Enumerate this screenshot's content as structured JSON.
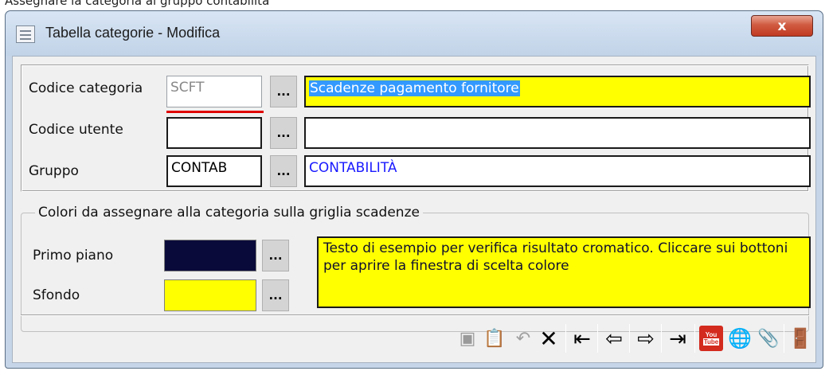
{
  "caption": "Assegnare la categoria al gruppo contabilità",
  "window": {
    "title": "Tabella categorie - Modifica",
    "close_label": "x"
  },
  "fields": {
    "codice_categoria": {
      "label": "Codice categoria",
      "code": "SCFT",
      "description": "Scadenze pagamento fornitore"
    },
    "codice_utente": {
      "label": "Codice utente",
      "code": "",
      "description": ""
    },
    "gruppo": {
      "label": "Gruppo",
      "code": "CONTAB",
      "description": "CONTABILITÀ"
    }
  },
  "dots_label": "...",
  "colors": {
    "legend": "Colori da assegnare alla categoria sulla griglia scadenze",
    "primo_piano": {
      "label": "Primo piano",
      "color": "#0a0a3a"
    },
    "sfondo": {
      "label": "Sfondo",
      "color": "#ffff00"
    },
    "sample_text": "Testo di esempio per verifica risultato cromatico. Cliccare sui bottoni per aprire la finestra di scelta colore"
  },
  "toolbar": [
    {
      "name": "save-icon",
      "glyph": "💾",
      "enabled": false
    },
    {
      "name": "clipboard-icon",
      "glyph": "📋",
      "enabled": true
    },
    {
      "name": "undo-icon",
      "glyph": "↶",
      "enabled": false
    },
    {
      "name": "delete-icon",
      "glyph": "✕",
      "enabled": true
    },
    {
      "name": "first-record-icon",
      "glyph": "⇤",
      "enabled": true
    },
    {
      "name": "prev-record-icon",
      "glyph": "⇐",
      "enabled": true
    },
    {
      "name": "next-record-icon",
      "glyph": "⇒",
      "enabled": true
    },
    {
      "name": "last-record-icon",
      "glyph": "⇥",
      "enabled": true
    },
    {
      "name": "youtube-icon",
      "glyph": "You Tube",
      "enabled": true
    },
    {
      "name": "web-help-icon",
      "glyph": "🌐",
      "enabled": true
    },
    {
      "name": "attachment-icon",
      "glyph": "📎",
      "enabled": false
    },
    {
      "name": "exit-icon",
      "glyph": "🚪",
      "enabled": true
    }
  ]
}
